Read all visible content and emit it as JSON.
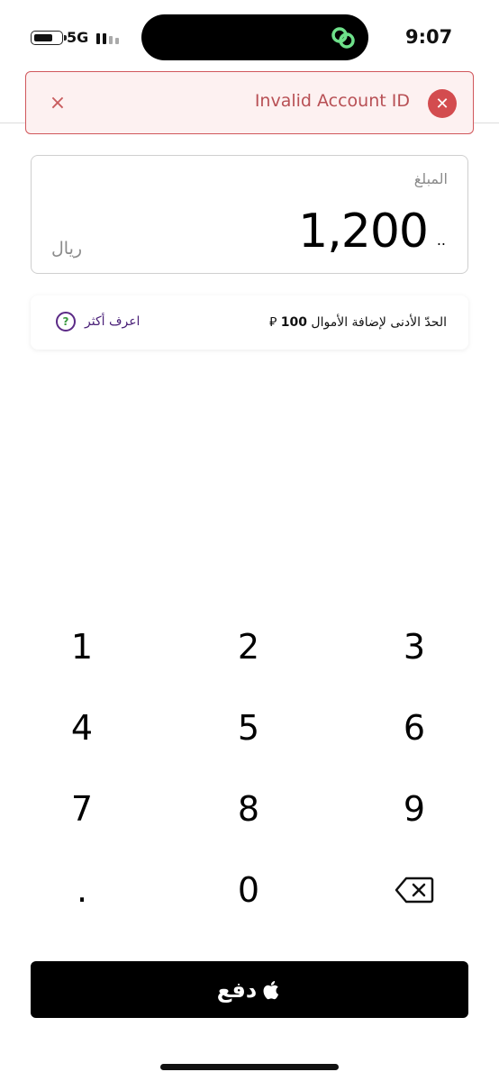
{
  "status_bar": {
    "network": "5G",
    "time": "9:07"
  },
  "toast": {
    "message": "Invalid Account ID",
    "close_glyph": "×",
    "error_glyph": "✕",
    "border_color": "#d0575b",
    "icon_color": "#d34c4f"
  },
  "amount": {
    "label": "المبلغ",
    "value": "1,200",
    "currency_mark": "..",
    "unit": "ريال"
  },
  "info": {
    "text_before": "الحدّ الأدنى لإضافة الأموال",
    "amount": "100",
    "currency_glyph": "⃁",
    "learn_more": "اعرف أكثر",
    "learn_icon": "?"
  },
  "keypad": {
    "keys": [
      "1",
      "2",
      "3",
      "4",
      "5",
      "6",
      "7",
      "8",
      "9",
      ".",
      "0"
    ],
    "backspace_icon": "backspace-icon"
  },
  "pay_button": {
    "label": "دفع",
    "icon": "apple-logo-icon",
    "background": "#000000"
  }
}
